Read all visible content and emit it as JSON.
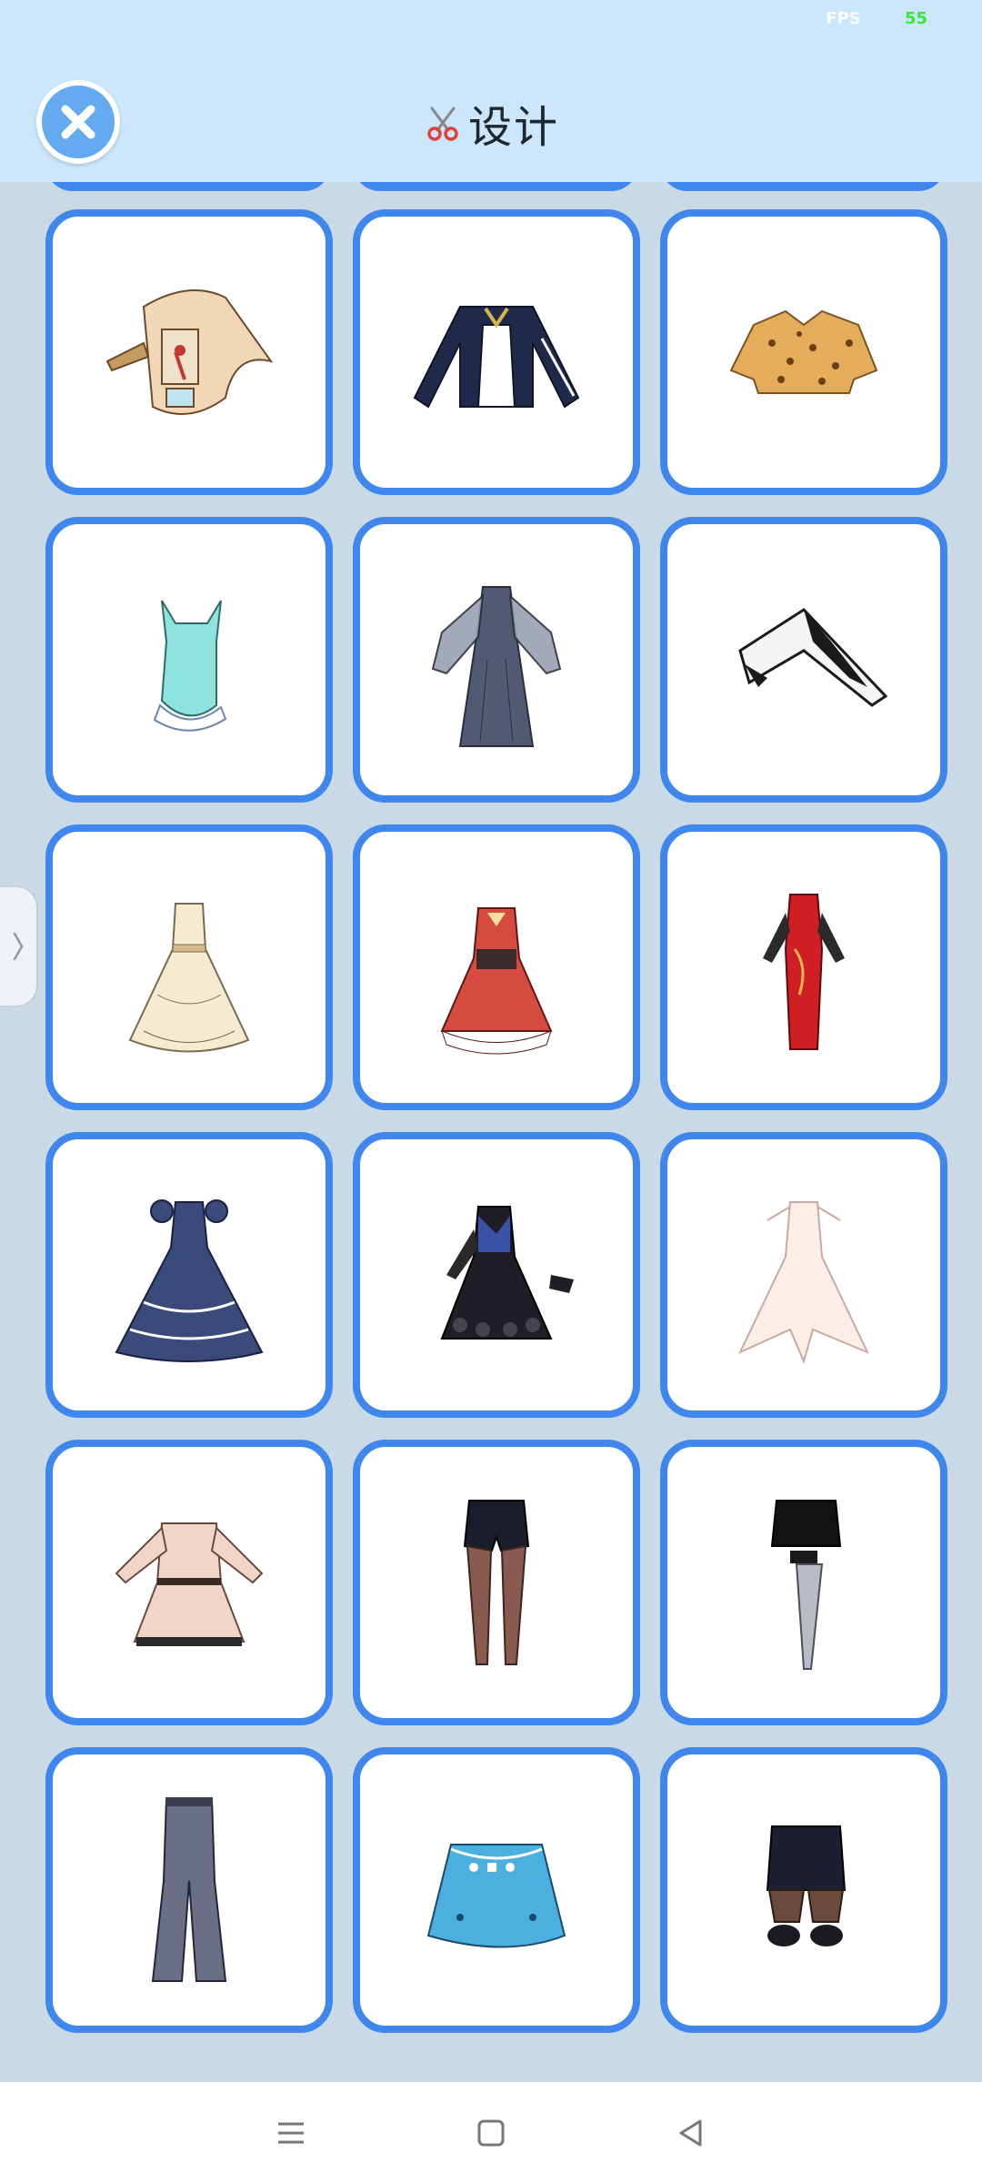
{
  "status": {
    "fps_label": "FPS",
    "fps_value": "55"
  },
  "header": {
    "title": "设计",
    "close_icon": "close-icon",
    "title_icon": "scissors-icon"
  },
  "colors": {
    "header_bg": "#cce6fb",
    "page_bg": "#c9d9e6",
    "card_border": "#3f87ec",
    "close_button": "#63aaf0"
  },
  "grid": {
    "columns": 3,
    "items": [
      {
        "name": "ornate-cape-outfit",
        "kind": "cape"
      },
      {
        "name": "navy-jacket",
        "kind": "jacket"
      },
      {
        "name": "leopard-crop-top",
        "kind": "top"
      },
      {
        "name": "mint-swimsuit",
        "kind": "swimsuit"
      },
      {
        "name": "grey-long-dress",
        "kind": "dress"
      },
      {
        "name": "black-white-cape",
        "kind": "cape"
      },
      {
        "name": "cream-ruffle-dress",
        "kind": "dress"
      },
      {
        "name": "red-lolita-dress",
        "kind": "dress"
      },
      {
        "name": "red-qipao",
        "kind": "dress"
      },
      {
        "name": "navy-music-ballgown",
        "kind": "dress"
      },
      {
        "name": "black-gothic-dress",
        "kind": "dress"
      },
      {
        "name": "white-gradient-gown",
        "kind": "dress"
      },
      {
        "name": "beige-wrap-dress",
        "kind": "dress"
      },
      {
        "name": "black-shorts-tights",
        "kind": "bottoms"
      },
      {
        "name": "black-shorts-leg-blade",
        "kind": "bottoms"
      },
      {
        "name": "grey-flare-pants",
        "kind": "pants"
      },
      {
        "name": "blue-card-skirt",
        "kind": "skirt"
      },
      {
        "name": "lace-shorts-boots",
        "kind": "bottoms"
      }
    ]
  },
  "side_handle": {
    "icon": "chevron-right-icon"
  },
  "nav": {
    "menu_icon": "menu-icon",
    "home_icon": "home-square-icon",
    "back_icon": "back-triangle-icon"
  }
}
